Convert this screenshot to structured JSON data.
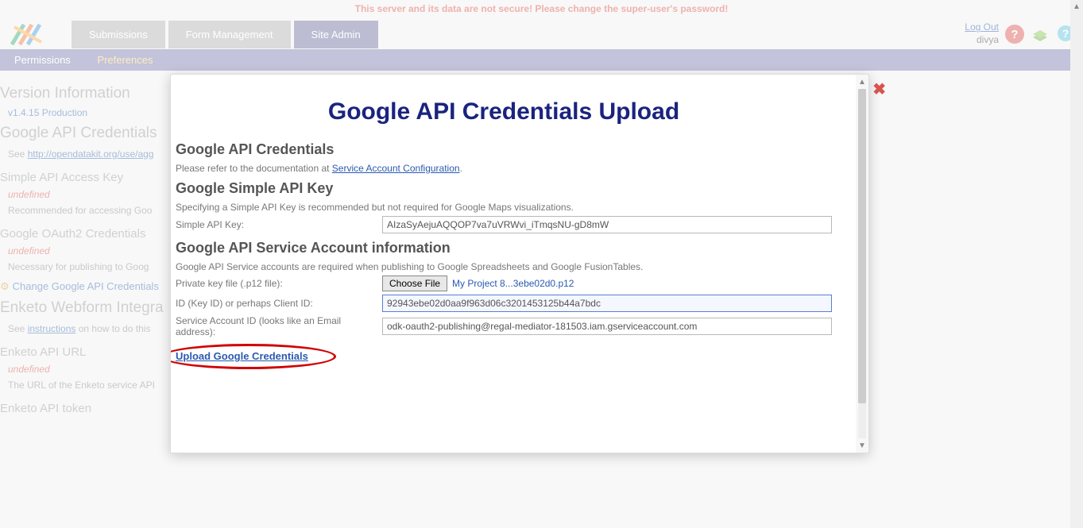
{
  "warning": "This server and its data are not secure! Please change the super-user's password!",
  "tabs": {
    "submissions": "Submissions",
    "form_mgmt": "Form Management",
    "site_admin": "Site Admin"
  },
  "user": {
    "logout": "Log Out",
    "name": "divya"
  },
  "subnav": {
    "permissions": "Permissions",
    "preferences": "Preferences"
  },
  "bg": {
    "version_h": "Version Information",
    "version": "v1.4.15 Production",
    "gac_h": "Google API Credentials",
    "gac_see_pre": "See ",
    "gac_see_link": "http://opendatakit.org/use/agg",
    "simple_h": "Simple API Access Key",
    "undef": "undefined",
    "simple_desc": "Recommended for accessing Goo",
    "oauth_h": "Google OAuth2 Credentials",
    "oauth_desc": "Necessary for publishing to Goog",
    "change": "Change Google API Credentials",
    "enketo_h": "Enketo Webform Integra",
    "enketo_see_pre": "See ",
    "enketo_see_link": "instructions",
    "enketo_see_post": " on how to do this",
    "enketo_url_h": "Enketo API URL",
    "enketo_url_desc": "The URL of the Enketo service API",
    "enketo_token_h": "Enketo API token"
  },
  "modal": {
    "title": "Google API Credentials Upload",
    "h1": "Google API Credentials",
    "refer_pre": "Please refer to the documentation at ",
    "refer_link": "Service Account Configuration",
    "h2": "Google Simple API Key",
    "simple_desc": "Specifying a Simple API Key is recommended but not required for Google Maps visualizations.",
    "simple_label": "Simple API Key:",
    "simple_value": "AIzaSyAejuAQQOP7va7uVRWvi_iTmqsNU-gD8mW",
    "h3": "Google API Service Account information",
    "svc_desc": "Google API Service accounts are required when publishing to Google Spreadsheets and Google FusionTables.",
    "pk_label": "Private key file (.p12 file):",
    "choose": "Choose File",
    "filename": "My Project 8...3ebe02d0.p12",
    "id_label": "ID (Key ID) or perhaps Client ID:",
    "id_value": "92943ebe02d0aa9f963d06c3201453125b44a7bdc",
    "email_label": "Service Account ID (looks like an Email address):",
    "email_value": "odk-oauth2-publishing@regal-mediator-181503.iam.gserviceaccount.com",
    "upload": "Upload Google Credentials"
  }
}
